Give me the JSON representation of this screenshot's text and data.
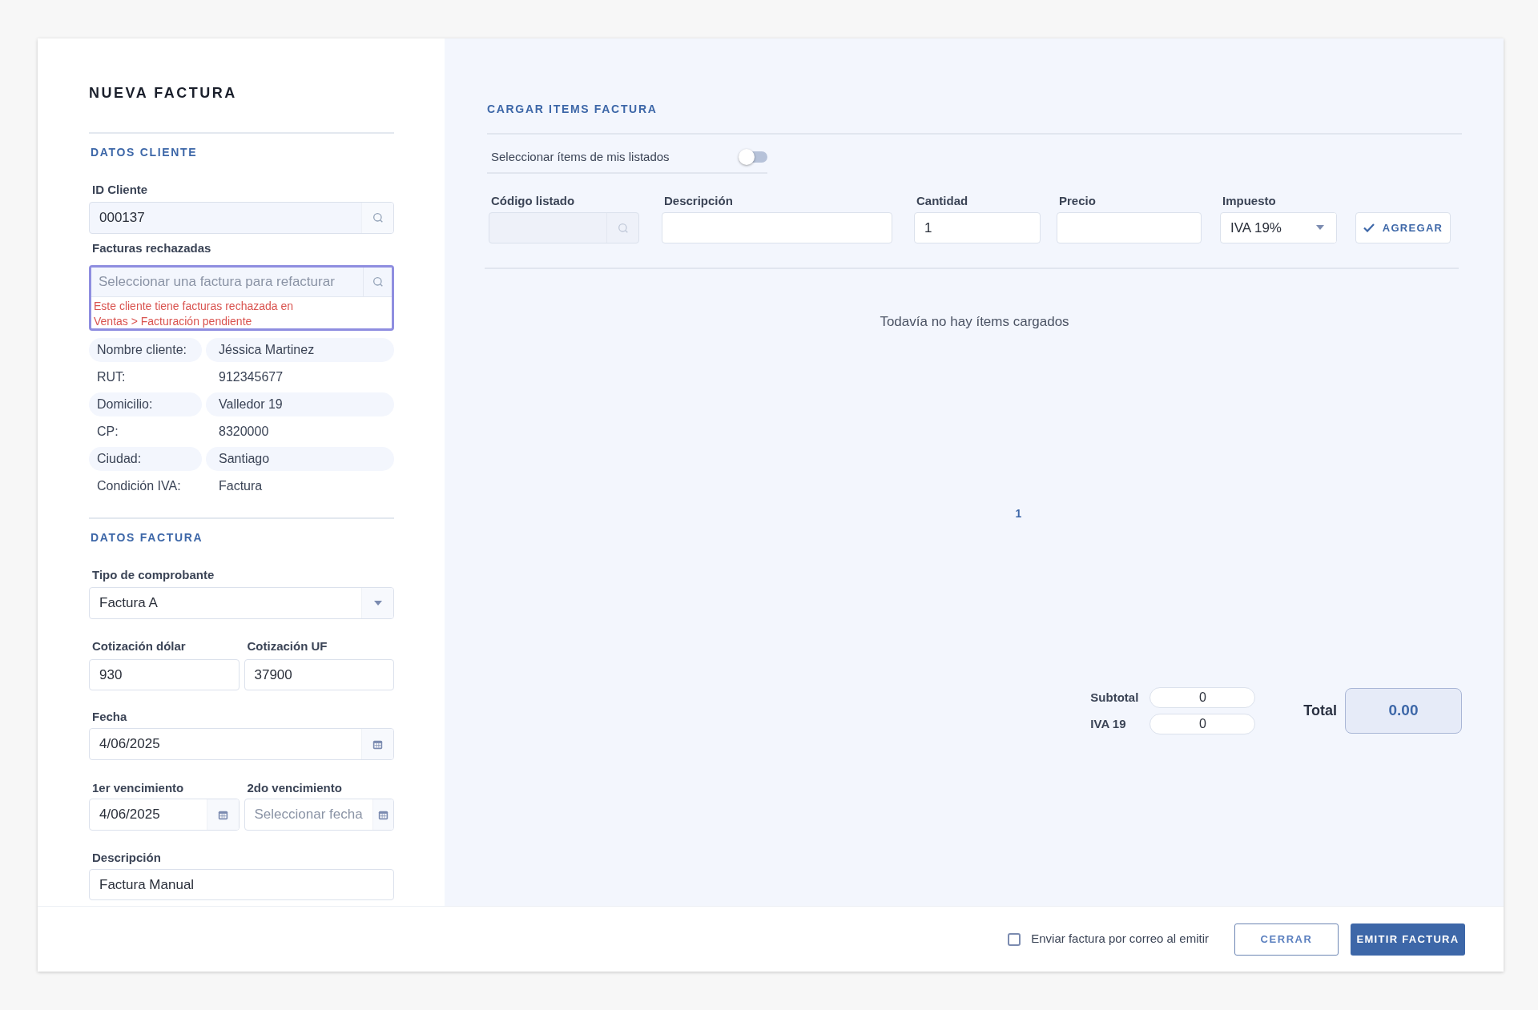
{
  "title": "NUEVA FACTURA",
  "client": {
    "heading": "DATOS CLIENTE",
    "id_field": {
      "label": "ID Cliente",
      "value": "000137"
    },
    "rejected": {
      "label": "Facturas rechazadas",
      "placeholder": "Seleccionar una factura para refacturar",
      "error": "Este cliente tiene facturas rechazada en Ventas > Facturación pendiente"
    },
    "info": [
      {
        "label": "Nombre cliente:",
        "value": "Jéssica Martinez"
      },
      {
        "label": "RUT:",
        "value": "912345677"
      },
      {
        "label": "Domicilio:",
        "value": "Valledor 19"
      },
      {
        "label": "CP:",
        "value": "8320000"
      },
      {
        "label": "Ciudad:",
        "value": "Santiago"
      },
      {
        "label": "Condición IVA:",
        "value": "Factura"
      }
    ]
  },
  "invoice": {
    "heading": "DATOS FACTURA",
    "type": {
      "label": "Tipo de comprobante",
      "value": "Factura A"
    },
    "rates": [
      {
        "label": "Cotización dólar",
        "value": "930"
      },
      {
        "label": "Cotización UF",
        "value": "37900"
      }
    ],
    "date": {
      "label": "Fecha",
      "value": "4/06/2025"
    },
    "due": [
      {
        "label": "1er vencimiento",
        "value": "4/06/2025"
      },
      {
        "label": "2do vencimiento",
        "placeholder": "Seleccionar fecha"
      }
    ],
    "description": {
      "label": "Descripción",
      "value": "Factura Manual"
    }
  },
  "items": {
    "heading": "CARGAR ITEMS FACTURA",
    "toggle": {
      "label": "Seleccionar ítems de mis listados",
      "on": false
    },
    "fields": [
      {
        "kind": "search",
        "label": "Código listado",
        "disabled": true
      },
      {
        "kind": "text",
        "label": "Descripción",
        "disabled": false
      },
      {
        "kind": "text",
        "label": "Cantidad",
        "value": "1",
        "disabled": false
      },
      {
        "kind": "text",
        "label": "Precio",
        "disabled": false
      },
      {
        "kind": "select",
        "label": "Impuesto",
        "value": "IVA 19%",
        "disabled": false
      }
    ],
    "add_button": "AGREGAR",
    "empty_message": "Todavía no hay ítems cargados",
    "pages": [
      {
        "label": "1",
        "selected": true
      }
    ],
    "totals": [
      {
        "label": "Subtotal",
        "value": "0"
      },
      {
        "label": "IVA 19",
        "value": "0"
      }
    ],
    "total": {
      "label": "Total",
      "value": "0.00"
    }
  },
  "footer": {
    "email": {
      "label": "Enviar factura por correo al emitir",
      "checked": false
    },
    "close_button": "CERRAR",
    "submit_button": "EMITIR FACTURA"
  }
}
